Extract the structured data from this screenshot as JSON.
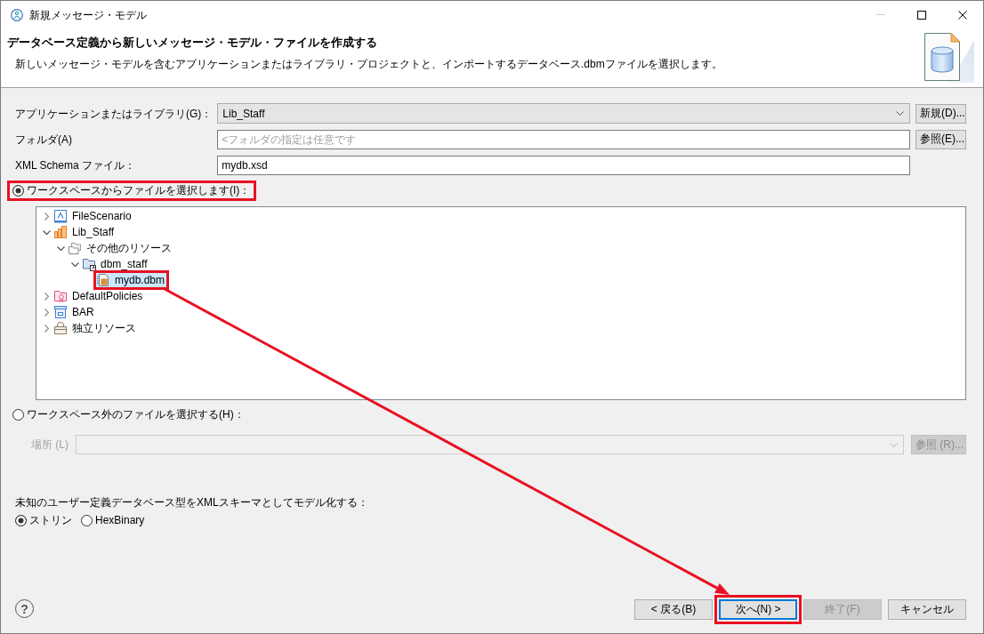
{
  "window": {
    "title": "新規メッセージ・モデル",
    "controls": [
      {
        "kind": "minimize",
        "disabled": true
      },
      {
        "kind": "maximize",
        "disabled": false
      },
      {
        "kind": "close",
        "disabled": false
      }
    ]
  },
  "header": {
    "title": "データベース定義から新しいメッセージ・モデル・ファイルを作成する",
    "description": "新しいメッセージ・モデルを含むアプリケーションまたはライブラリ・プロジェクトと、インポートするデータベース.dbmファイルを選択します。"
  },
  "fields": [
    {
      "kind": "combo",
      "label": "アプリケーションまたはライブラリ(G)：",
      "value": "Lib_Staff",
      "button": "新規(D)..."
    },
    {
      "kind": "text",
      "label": "フォルダ(A)",
      "placeholder": "<フォルダの指定は任意です",
      "button": "参照(E)..."
    },
    {
      "kind": "text",
      "label": "XML Schema ファイル：",
      "value": "mydb.xsd"
    }
  ],
  "workspace_source": {
    "label": "ワークスペースからファイルを選択します(I)：",
    "selected": true,
    "highlighted": true,
    "tree": [
      {
        "label": "FileScenario",
        "kind": "scenario",
        "expanded": false,
        "selected": false,
        "highlighted": false
      },
      {
        "label": "Lib_Staff",
        "kind": "library",
        "expanded": true,
        "selected": false,
        "highlighted": false,
        "children": [
          {
            "label": "その他のリソース",
            "kind": "resources",
            "expanded": true,
            "selected": false,
            "highlighted": false,
            "children": [
              {
                "label": "dbm_staff",
                "kind": "folder",
                "expanded": true,
                "selected": false,
                "highlighted": false,
                "children": [
                  {
                    "label": "mydb.dbm",
                    "kind": "dbmfile",
                    "selected": true,
                    "highlighted": true
                  }
                ]
              }
            ]
          }
        ]
      },
      {
        "label": "DefaultPolicies",
        "kind": "policies",
        "expanded": false,
        "selected": false,
        "highlighted": false
      },
      {
        "label": "BAR",
        "kind": "bar",
        "expanded": false,
        "selected": false,
        "highlighted": false
      },
      {
        "label": "独立リソース",
        "kind": "shared",
        "expanded": false,
        "selected": false,
        "highlighted": false
      }
    ]
  },
  "external_source": {
    "label": "ワークスペース外のファイルを選択する(H)：",
    "selected": false,
    "highlighted": false,
    "location": {
      "label": "場所 (L)",
      "disabled": true
    },
    "browse_button": {
      "label": "参照 (R)...",
      "disabled": true
    }
  },
  "type_mapping": {
    "label": "未知のユーザー定義データベース型をXMLスキーマとしてモデル化する：",
    "options": [
      {
        "label": "ストリン",
        "selected": true
      },
      {
        "label": "HexBinary",
        "selected": false
      }
    ]
  },
  "help_button": {
    "label": "?"
  },
  "buttons": [
    {
      "label": "< 戻る(B)",
      "default": false,
      "disabled": false,
      "highlighted": false
    },
    {
      "label": "次へ(N) >",
      "default": true,
      "disabled": false,
      "highlighted": true
    },
    {
      "label": "終了(F)",
      "default": false,
      "disabled": true,
      "highlighted": false
    },
    {
      "label": "キャンセル",
      "default": false,
      "disabled": false,
      "highlighted": false
    }
  ],
  "annotation_arrow": true
}
